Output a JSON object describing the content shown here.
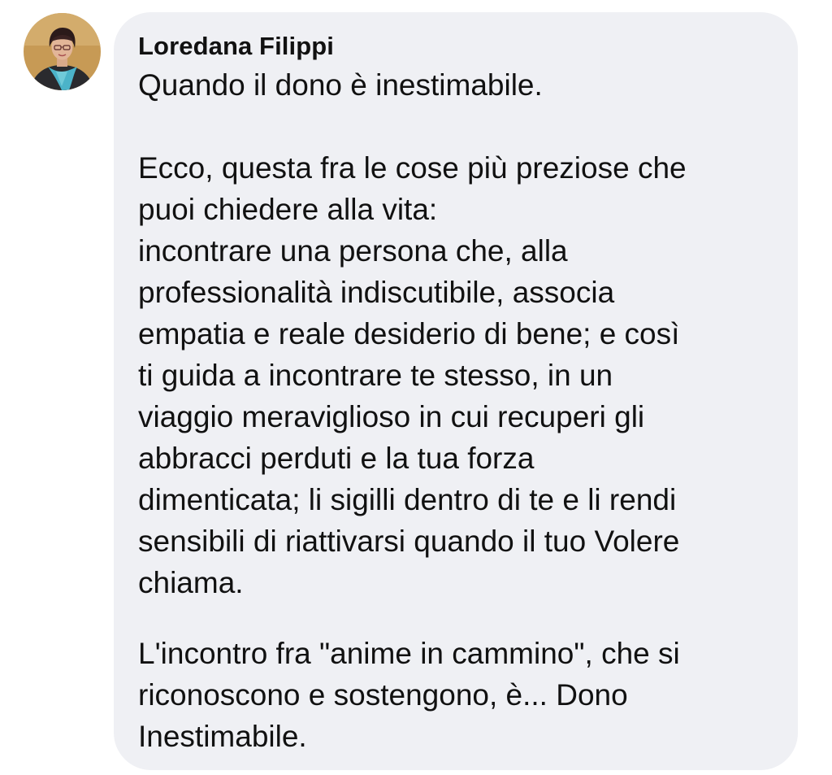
{
  "comment": {
    "author": "Loredana Filippi",
    "paragraphs": [
      [
        "Quando il dono è inestimabile."
      ],
      [
        "Ecco, questa fra le cose più preziose che",
        "puoi chiedere alla vita:",
        "incontrare una persona che, alla",
        "professionalità indiscutibile, associa",
        "empatia e reale desiderio di bene; e così",
        "ti guida a incontrare te stesso, in un",
        "viaggio meraviglioso in cui recuperi gli",
        "abbracci perduti e la tua forza",
        "dimenticata; li sigilli dentro di te e li rendi",
        "sensibili di riattivarsi quando il tuo Volere",
        "chiama."
      ],
      [
        "L'incontro fra \"anime in cammino\", che si",
        "riconoscono e sostengono, è... Dono",
        "Inestimabile."
      ]
    ]
  },
  "colors": {
    "bubble_background": "#eff0f4",
    "text": "#111111",
    "avatar_background": "#c79a55",
    "avatar_scarf": "#4bb3c9"
  },
  "icons": {
    "avatar": "profile-photo"
  }
}
